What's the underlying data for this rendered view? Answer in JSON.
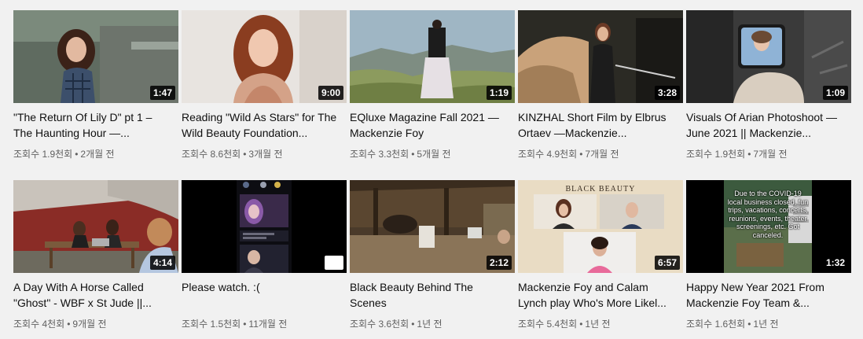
{
  "videos": [
    {
      "title": "\"The Return Of Lily D\" pt 1 – The Haunting Hour —...",
      "duration": "1:47",
      "views": "조회수 1.9천회",
      "age": "2개월 전"
    },
    {
      "title": "Reading \"Wild As Stars\" for The Wild Beauty Foundation...",
      "duration": "9:00",
      "views": "조회수 8.6천회",
      "age": "3개월 전"
    },
    {
      "title": "EQluxe Magazine Fall 2021 — Mackenzie Foy",
      "duration": "1:19",
      "views": "조회수 3.3천회",
      "age": "5개월 전"
    },
    {
      "title": "KINZHAL Short Film by Elbrus Ortaev —Mackenzie...",
      "duration": "3:28",
      "views": "조회수 4.9천회",
      "age": "7개월 전"
    },
    {
      "title": "Visuals Of Arian Photoshoot — June 2021 || Mackenzie...",
      "duration": "1:09",
      "views": "조회수 1.9천회",
      "age": "7개월 전"
    },
    {
      "title": "A Day With A Horse Called \"Ghost\" - WBF x St Jude ||...",
      "duration": "4:14",
      "views": "조회수 4천회",
      "age": "9개월 전"
    },
    {
      "title": "Please watch. :(",
      "duration": "",
      "views": "조회수 1.5천회",
      "age": "11개월 전"
    },
    {
      "title": "Black Beauty Behind The Scenes",
      "duration": "2:12",
      "views": "조회수 3.6천회",
      "age": "1년 전"
    },
    {
      "title": "Mackenzie Foy and Calam Lynch play Who's More Likel...",
      "duration": "6:57",
      "views": "조회수 5.4천회",
      "age": "1년 전"
    },
    {
      "title": "Happy New Year 2021 From Mackenzie Foy Team &...",
      "duration": "1:32",
      "views": "조회수 1.6천회",
      "age": "1년 전"
    }
  ],
  "thumb_text": {
    "black_beauty": "BLACK BEAUTY",
    "covid_note": "Due to the COVID-19 local business closed, fun trips, vacations, concerts, reunions, events, theater screenings, etc. Got canceled."
  },
  "icons": {
    "shorts": "shorts-icon"
  }
}
